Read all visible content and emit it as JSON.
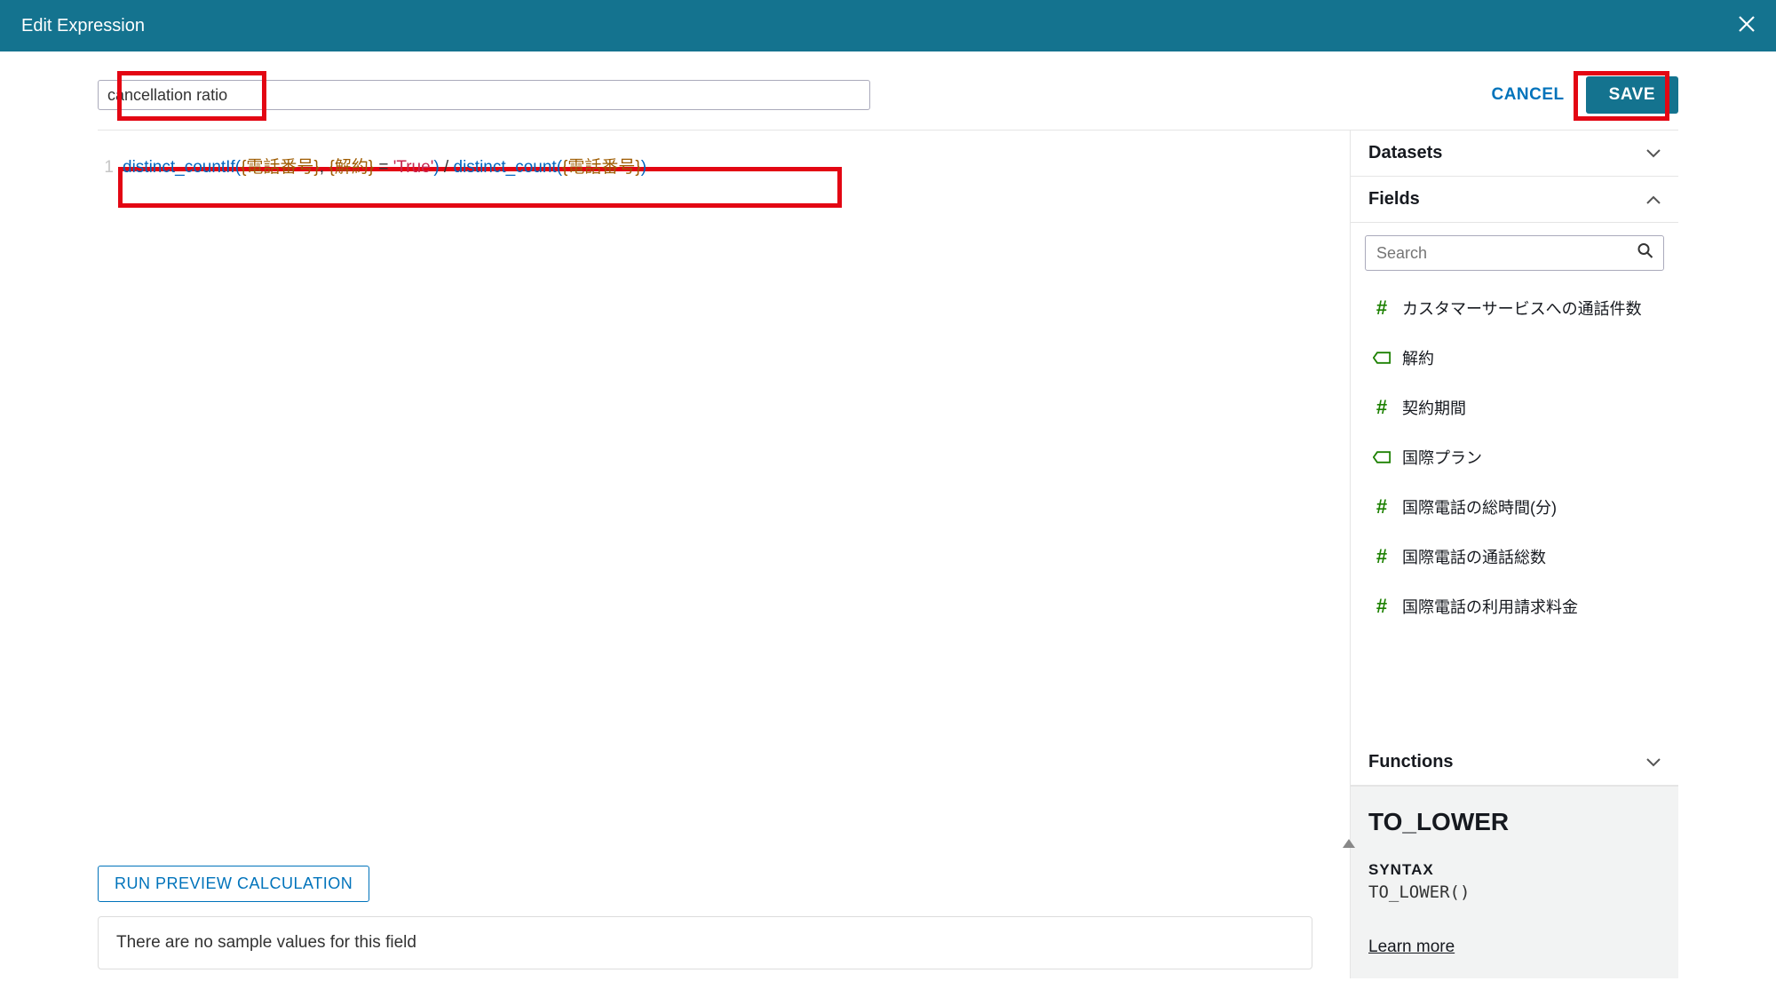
{
  "header": {
    "title": "Edit Expression"
  },
  "toolbar": {
    "name_value": "cancellation ratio",
    "cancel_label": "CANCEL",
    "save_label": "SAVE"
  },
  "editor": {
    "line_number": "1",
    "tokens": {
      "fn1": "distinct_countIf",
      "lp1": "(",
      "field1": "{電話番号}",
      "comma": ", ",
      "field2": "{解約}",
      "eq": " = ",
      "str1": "'True'",
      "rp1": ")",
      "div": " / ",
      "fn2": "distinct_count",
      "lp2": "(",
      "field3": "{電話番号}",
      "rp2": ")"
    },
    "run_preview_label": "RUN PREVIEW CALCULATION",
    "no_samples_text": "There are no sample values for this field"
  },
  "sidebar": {
    "datasets_label": "Datasets",
    "fields_label": "Fields",
    "functions_label": "Functions",
    "search_placeholder": "Search",
    "fields": [
      {
        "type": "num",
        "label": "カスタマーサービスへの通話件数"
      },
      {
        "type": "tag",
        "label": "解約"
      },
      {
        "type": "num",
        "label": "契約期間"
      },
      {
        "type": "tag",
        "label": "国際プラン"
      },
      {
        "type": "num",
        "label": "国際電話の総時間(分)"
      },
      {
        "type": "num",
        "label": "国際電話の通話総数"
      },
      {
        "type": "num",
        "label": "国際電話の利用請求料金"
      }
    ],
    "fn_detail": {
      "name": "TO_LOWER",
      "syntax_label": "SYNTAX",
      "syntax": "TO_LOWER()",
      "learn_more": "Learn more"
    }
  }
}
